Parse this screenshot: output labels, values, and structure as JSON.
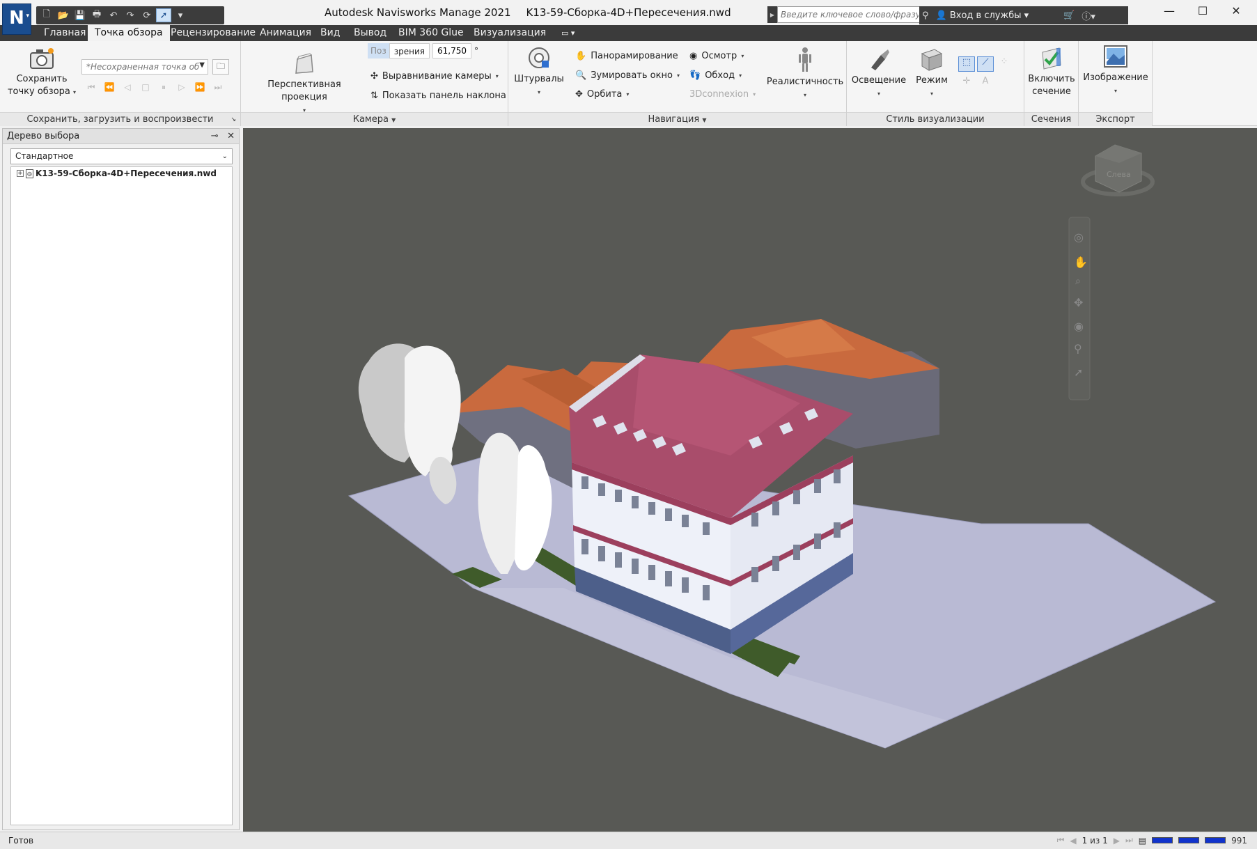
{
  "app": {
    "title": "Autodesk Navisworks Manage 2021",
    "file_name": "K13-59-Сборка-4D+Пересечения.nwd",
    "logo": "N"
  },
  "search": {
    "placeholder": "Введите ключевое слово/фразу"
  },
  "services": {
    "sign_in": "Вход в службы"
  },
  "tabs": [
    "Главная",
    "Точка обзора",
    "Рецензирование",
    "Анимация",
    "Вид",
    "Вывод",
    "BIM 360 Glue",
    "Визуализация"
  ],
  "active_tab": "Точка обзора",
  "ribbon": {
    "save_panel": {
      "save_button": "Сохранить точку обзора",
      "save_line1": "Сохранить",
      "save_line2": "точку обзора",
      "viewpoint_select": "*Несохраненная точка об",
      "title": "Сохранить, загрузить и воспроизвести"
    },
    "camera_panel": {
      "fov_label_a": "Поз",
      "fov_label_b": "зрения",
      "fov_value": "61,750",
      "fov_unit": "°",
      "perspective": "Перспективная проекция",
      "align_camera": "Выравнивание камеры",
      "show_tilt": "Показать панель наклона",
      "title": "Камера"
    },
    "navigation_panel": {
      "steering": "Штурвалы",
      "pan": "Панорамирование",
      "zoom_window": "Зумировать окно",
      "orbit": "Орбита",
      "look": "Осмотр",
      "walk": "Обход",
      "connexion": "3Dconnexion",
      "realism": "Реалистичность",
      "title": "Навигация"
    },
    "render_style_panel": {
      "lighting": "Освещение",
      "mode": "Режим",
      "title": "Стиль визуализации"
    },
    "sectioning_panel": {
      "enable_line1": "Включить",
      "enable_line2": "сечение",
      "title": "Сечения"
    },
    "export_panel": {
      "image": "Изображение",
      "title": "Экспорт"
    }
  },
  "selection_tree": {
    "title": "Дерево выбора",
    "mode": "Стандартное",
    "root_item": "K13-59-Сборка-4D+Пересечения.nwd"
  },
  "viewcube": {
    "face_label": "Слева"
  },
  "status": {
    "text": "Готов",
    "page": "1 из 1",
    "memory": "991"
  },
  "colors": {
    "viewport_bg": "#585955",
    "roof_main": "#a94d6b",
    "roof_orange": "#c96a3e",
    "facade": "#eef1f9",
    "plinth": "#4d5f8a",
    "ground": "#b9bad4",
    "grass": "#3f5b2a",
    "tab_bar": "#3b3b3b"
  }
}
